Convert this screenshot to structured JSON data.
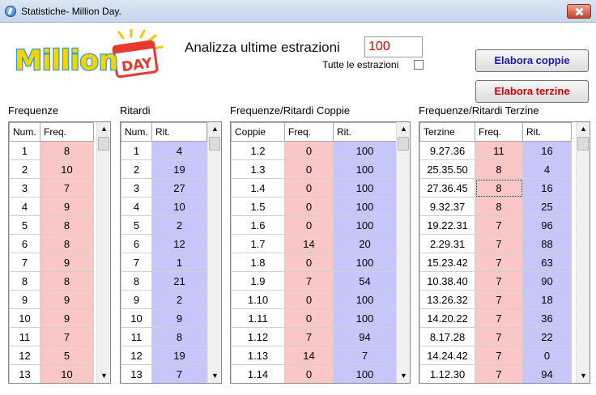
{
  "window": {
    "title": "Statistiche- Million Day."
  },
  "logo": {
    "word1": "Million",
    "word2": "DAY"
  },
  "controls": {
    "analizza_label": "Analizza ultime estrazioni",
    "analizza_value": "100",
    "tutte_label": "Tutte le estrazioni",
    "tutte_checked": false,
    "btn_coppie": "Elabora coppie",
    "btn_terzine": "Elabora terzine"
  },
  "colors": {
    "freq_bg": "#fbc6c6",
    "rit_bg": "#c6c6fb",
    "coppie_btn": "#1a1aa8",
    "terzine_btn": "#d40000",
    "input_text": "#e00000"
  },
  "frequenze": {
    "label": "Frequenze",
    "headers": [
      "Num.",
      "Freq."
    ],
    "rows": [
      [
        "1",
        "8"
      ],
      [
        "2",
        "10"
      ],
      [
        "3",
        "7"
      ],
      [
        "4",
        "9"
      ],
      [
        "5",
        "8"
      ],
      [
        "6",
        "8"
      ],
      [
        "7",
        "9"
      ],
      [
        "8",
        "8"
      ],
      [
        "9",
        "9"
      ],
      [
        "10",
        "9"
      ],
      [
        "11",
        "7"
      ],
      [
        "12",
        "5"
      ],
      [
        "13",
        "10"
      ]
    ]
  },
  "ritardi": {
    "label": "Ritardi",
    "headers": [
      "Num.",
      "Rit."
    ],
    "rows": [
      [
        "1",
        "4"
      ],
      [
        "2",
        "19"
      ],
      [
        "3",
        "27"
      ],
      [
        "4",
        "10"
      ],
      [
        "5",
        "2"
      ],
      [
        "6",
        "12"
      ],
      [
        "7",
        "1"
      ],
      [
        "8",
        "21"
      ],
      [
        "9",
        "2"
      ],
      [
        "10",
        "9"
      ],
      [
        "11",
        "8"
      ],
      [
        "12",
        "19"
      ],
      [
        "13",
        "7"
      ]
    ]
  },
  "coppie": {
    "label": "Frequenze/Ritardi Coppie",
    "headers": [
      "Coppie",
      "Freq.",
      "Rit."
    ],
    "rows": [
      [
        "1.2",
        "0",
        "100"
      ],
      [
        "1.3",
        "0",
        "100"
      ],
      [
        "1.4",
        "0",
        "100"
      ],
      [
        "1.5",
        "0",
        "100"
      ],
      [
        "1.6",
        "0",
        "100"
      ],
      [
        "1.7",
        "14",
        "20"
      ],
      [
        "1.8",
        "0",
        "100"
      ],
      [
        "1.9",
        "7",
        "54"
      ],
      [
        "1.10",
        "0",
        "100"
      ],
      [
        "1.11",
        "0",
        "100"
      ],
      [
        "1.12",
        "7",
        "94"
      ],
      [
        "1.13",
        "14",
        "7"
      ],
      [
        "1.14",
        "0",
        "100"
      ]
    ]
  },
  "terzine": {
    "label": "Frequenze/Ritardi Terzine",
    "headers": [
      "Terzine",
      "Freq.",
      "Rit."
    ],
    "rows": [
      [
        "9.27.36",
        "11",
        "16"
      ],
      [
        "25.35.50",
        "8",
        "4"
      ],
      [
        "27.36.45",
        "8",
        "16"
      ],
      [
        "9.32.37",
        "8",
        "25"
      ],
      [
        "19.22.31",
        "7",
        "96"
      ],
      [
        "2.29.31",
        "7",
        "88"
      ],
      [
        "15.23.42",
        "7",
        "63"
      ],
      [
        "10.38.40",
        "7",
        "90"
      ],
      [
        "13.26.32",
        "7",
        "18"
      ],
      [
        "14.20.22",
        "7",
        "36"
      ],
      [
        "8.17.28",
        "7",
        "22"
      ],
      [
        "14.24.42",
        "7",
        "0"
      ],
      [
        "1.12.30",
        "7",
        "94"
      ]
    ]
  }
}
